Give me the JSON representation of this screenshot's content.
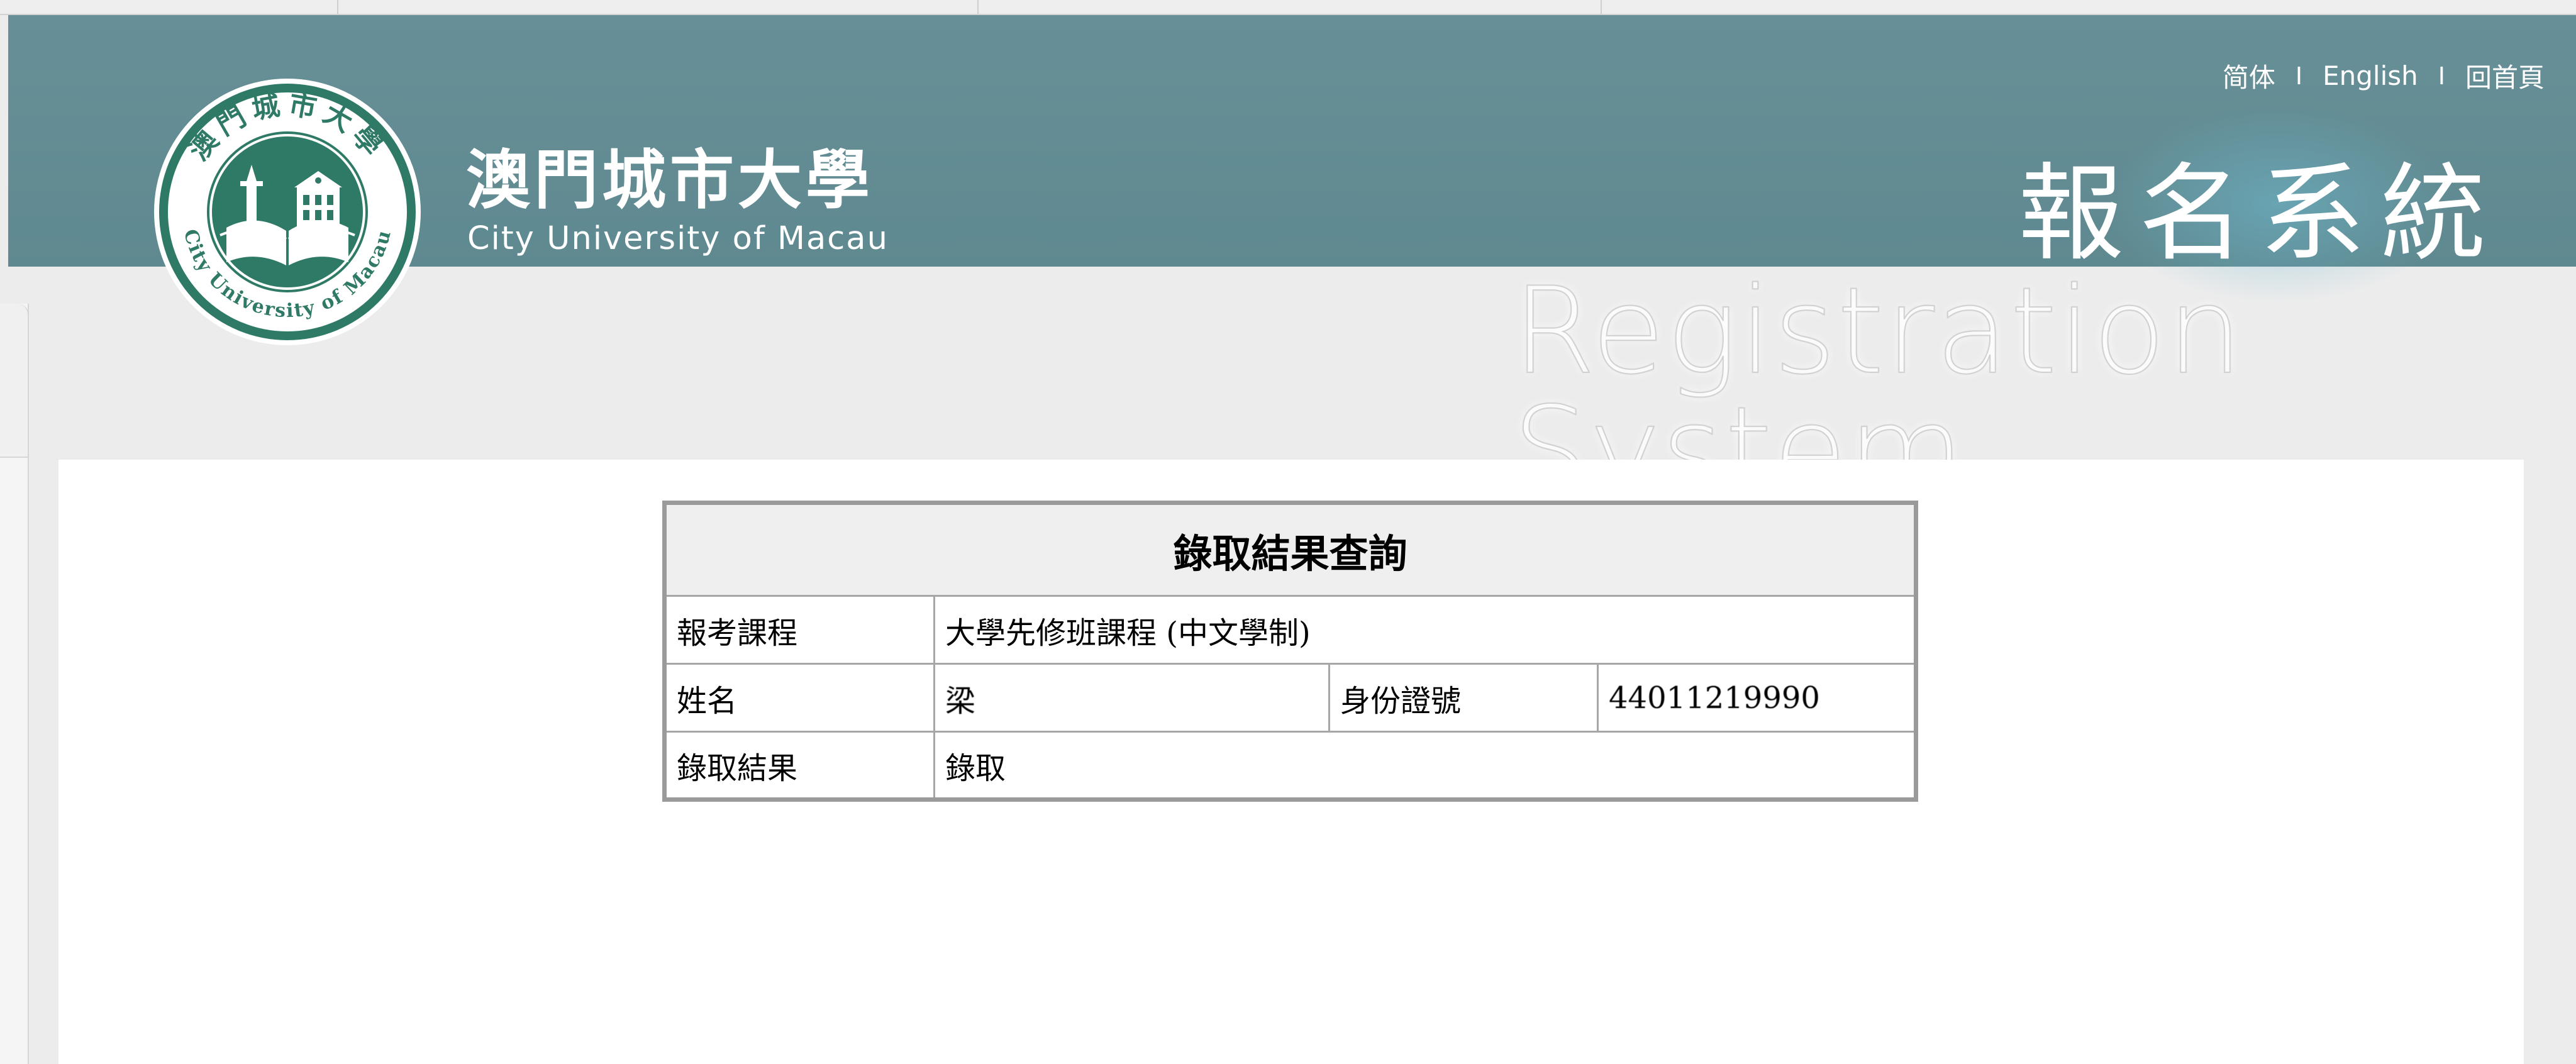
{
  "header": {
    "links": [
      "简体",
      "English",
      "回首頁"
    ],
    "separator": "I",
    "school_name_cn": "澳門城市大學",
    "school_name_en": "City University of Macau",
    "system_name_cn": "報名系統",
    "system_name_en": "Registration System",
    "logo_top_text": "澳門城市大學",
    "logo_bottom_text": "City University of Macau"
  },
  "result": {
    "title": "錄取結果查詢",
    "course_label": "報考課程",
    "course_value": "大學先修班課程 (中文學制)",
    "name_label": "姓名",
    "name_value": "梁",
    "id_label": "身份證號",
    "id_value": "44011219990",
    "admission_label": "錄取結果",
    "admission_value": "錄取"
  },
  "colors": {
    "header_bg": "#638c93",
    "logo_green": "#2f7a66",
    "page_bg": "#ececec",
    "table_border": "#9a9a9a"
  }
}
